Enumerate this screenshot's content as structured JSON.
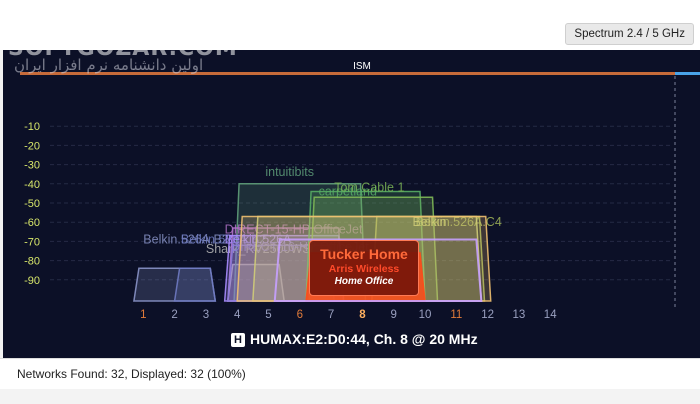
{
  "app": {
    "band_label": "Spectrum 2.4 / 5 GHz",
    "watermark": "SOFTGOZAR.COM",
    "watermark_sub": "اولین دانشنامه نرم افزار ایران"
  },
  "chart_data": {
    "type": "area",
    "title": "",
    "band_name": "ISM",
    "xlabel": "",
    "ylabel": "",
    "x_ticks": [
      "1",
      "2",
      "3",
      "4",
      "5",
      "6",
      "7",
      "8",
      "9",
      "10",
      "11",
      "12",
      "13",
      "14"
    ],
    "x_tick_highlight": [
      "1",
      "6",
      "8",
      "11"
    ],
    "y_ticks": [
      "-10",
      "-20",
      "-30",
      "-40",
      "-50",
      "-60",
      "-70",
      "-80",
      "-90"
    ],
    "ylim": [
      -100,
      0
    ],
    "grid": true,
    "networks": [
      {
        "name": "Belkin.526A.B2",
        "from": 0.7,
        "to": 3.3,
        "signal": -84,
        "color": "#8a94c8",
        "label_x": 1.0,
        "label_y": -71
      },
      {
        "name": "Belkin.526A.B2",
        "from": 2.0,
        "to": 3.3,
        "signal": -84,
        "color": "#6f7ac2",
        "label_x": 2.2,
        "label_y": -71
      },
      {
        "name": "Shark_RV2500WS",
        "from": 3.7,
        "to": 5.5,
        "signal": -82,
        "color": "#b9b9b9",
        "label_x": 3.0,
        "label_y": -76
      },
      {
        "name": "intuitibits",
        "from": 3.9,
        "to": 8.1,
        "signal": -40,
        "color": "#5f9f7a",
        "label_x": 4.9,
        "label_y": -36
      },
      {
        "name": "DIRECT-15-HP OfficeJet",
        "from": 3.7,
        "to": 7.4,
        "signal": -63,
        "color": "#b072c8",
        "label_x": 3.6,
        "label_y": -66
      },
      {
        "name": "Belkin.526A",
        "from": 3.6,
        "to": 7.4,
        "signal": -67,
        "color": "#a98cff",
        "label_x": 3.6,
        "label_y": -71
      },
      {
        "name": "DIRECT-16-HP OfficeJet",
        "from": 3.7,
        "to": 7.1,
        "signal": -72,
        "color": "#8a7ad8",
        "label_x": 3.8,
        "label_y": -75
      },
      {
        "name": "carpetland",
        "from": 6.2,
        "to": 10.0,
        "signal": -44,
        "color": "#56ad65",
        "label_x": 6.6,
        "label_y": -46
      },
      {
        "name": "Tom Cable 1",
        "from": 6.3,
        "to": 10.4,
        "signal": -47,
        "color": "#7eb857",
        "label_x": 7.1,
        "label_y": -44
      },
      {
        "name": "Belkin.526A.C4",
        "from": 8.3,
        "to": 11.9,
        "signal": -57,
        "color": "#a4b859",
        "label_x": 9.7,
        "label_y": -62
      },
      {
        "name": "Belkin",
        "from": 4.5,
        "to": 11.8,
        "signal": -57,
        "color": "#c7d07a",
        "label_x": 9.6,
        "label_y": -62
      },
      {
        "name": "Home Office",
        "from": 4.0,
        "to": 12.1,
        "signal": -57,
        "color": "#f0c070",
        "label_x": 0,
        "label_y": 0
      },
      {
        "name": "Tucker Home",
        "from": 6.2,
        "to": 10.0,
        "signal": -76,
        "color": "#ff4a1a",
        "label_x": 0,
        "label_y": 0
      },
      {
        "name": "HUMAX",
        "from": 5.2,
        "to": 11.8,
        "signal": -69,
        "color": "#c6a0ff",
        "label_x": 0,
        "label_y": 0
      }
    ],
    "popup": {
      "title": "Tucker Home",
      "vendor": "Arris Wireless",
      "group": "Home Office"
    }
  },
  "selected_network": {
    "label": "HUMAX:E2:D0:44, Ch. 8 @ 20 MHz",
    "icon": "H"
  },
  "status": {
    "text": "Networks Found: 32, Displayed: 32 (100%)"
  }
}
